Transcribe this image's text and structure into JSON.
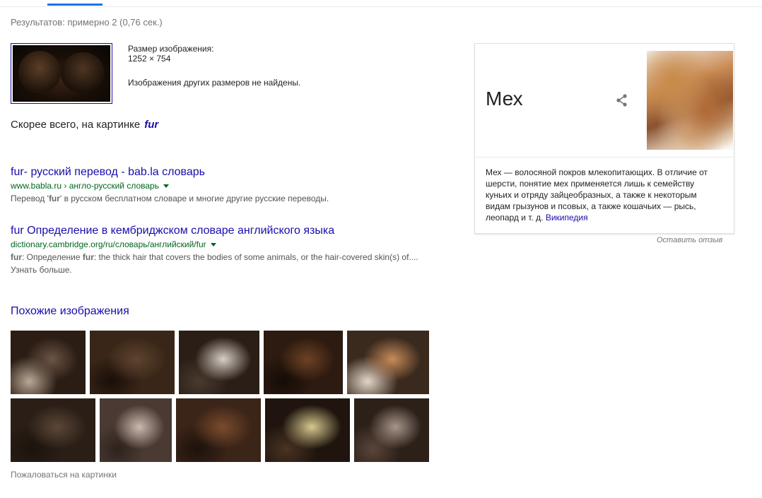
{
  "stats": "Результатов: примерно 2 (0,76 сек.)",
  "image_info": {
    "size_label": "Размер изображения:",
    "size_value": "1252 × 754",
    "no_other_sizes": "Изображения других размеров не найдены."
  },
  "best_guess": {
    "prefix": "Скорее всего, на картинке",
    "query": "fur"
  },
  "results": [
    {
      "title": "fur- русский перевод - bab.la словарь",
      "url": "www.babla.ru › англо-русский словарь",
      "snippet_pre": "Перевод '",
      "snippet_bold": "fur",
      "snippet_post": "' в русском бесплатном словаре и многие другие русские переводы."
    },
    {
      "title": "fur Определение в кембриджском словаре английского языка",
      "url": "dictionary.cambridge.org/ru/словарь/английский/fur",
      "snippet_b1": "fur",
      "snippet_t1": ": Определение ",
      "snippet_b2": "fur",
      "snippet_t2": ": the thick hair that covers the bodies of some animals, or the hair-covered skin(s) of.... Узнать больше."
    }
  ],
  "similar_heading": "Похожие изображения",
  "similar_images": [
    {
      "name": "similar-image-1",
      "colors": [
        "#2b1d14",
        "#6b5546",
        "#b9a895"
      ]
    },
    {
      "name": "similar-image-2",
      "colors": [
        "#3a2618",
        "#5e4330",
        "#1a0f08"
      ]
    },
    {
      "name": "similar-image-3",
      "colors": [
        "#2a1e16",
        "#d8cfc6",
        "#4a3a30"
      ]
    },
    {
      "name": "similar-image-4",
      "colors": [
        "#2d1a10",
        "#6c4224",
        "#140c07"
      ]
    },
    {
      "name": "similar-image-5",
      "colors": [
        "#3a2a1e",
        "#c98c5a",
        "#e3d6c8"
      ]
    },
    {
      "name": "similar-image-6",
      "colors": [
        "#2a1e16",
        "#5b4738",
        "#1c130d"
      ]
    },
    {
      "name": "similar-image-7",
      "colors": [
        "#4a3a33",
        "#cbb9ae",
        "#2e221c"
      ]
    },
    {
      "name": "similar-image-8",
      "colors": [
        "#3b2418",
        "#7a4b2c",
        "#1d120b"
      ]
    },
    {
      "name": "similar-image-9",
      "colors": [
        "#1f150e",
        "#d7c98e",
        "#4a3322"
      ]
    },
    {
      "name": "similar-image-10",
      "colors": [
        "#2c2019",
        "#a9968a",
        "#5a463a"
      ]
    }
  ],
  "report": "Пожаловаться на картинки",
  "knowledge_panel": {
    "title": "Мех",
    "description": "Мех — волосяной покров млекопитающих. В отличие от шерсти, понятие мех применяется лишь к семейству куньих и отряду зайцеобразных, а также к некоторым видам грызунов и псовых, а также кошачьих — рысь, леопард и т. д.",
    "source_link": "Википедия"
  },
  "feedback": "Оставить отзыв",
  "colors": {
    "link": "#1a0dab",
    "url_green": "#006621",
    "muted": "#70757a",
    "tab_accent": "#1a73e8"
  }
}
